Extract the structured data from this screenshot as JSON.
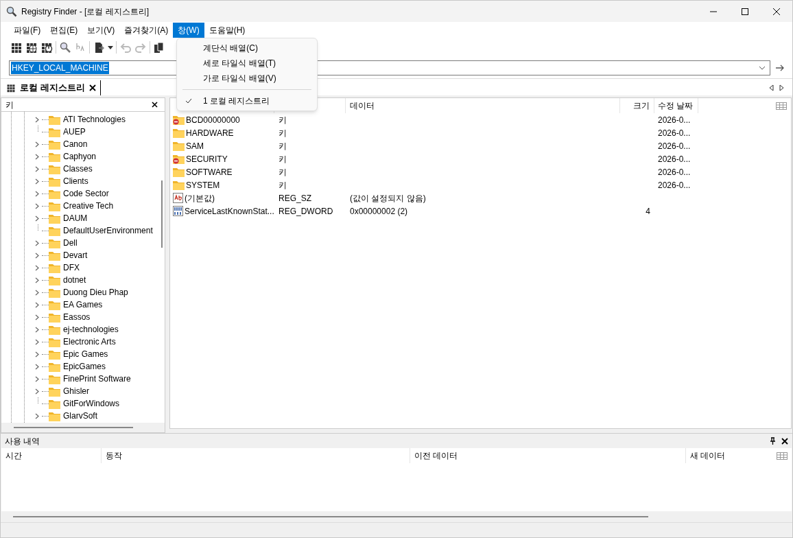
{
  "window": {
    "title": "Registry Finder - [로컬 레지스트리]"
  },
  "menu_bar": [
    {
      "label": "파일(F)",
      "selected": false
    },
    {
      "label": "편집(E)",
      "selected": false
    },
    {
      "label": "보기(V)",
      "selected": false
    },
    {
      "label": "즐겨찾기(A)",
      "selected": false
    },
    {
      "label": "창(W)",
      "selected": true
    },
    {
      "label": "도움말(H)",
      "selected": false
    }
  ],
  "dropdown": {
    "items": [
      {
        "kind": "command",
        "label": "계단식 배열(C)",
        "checked": false
      },
      {
        "kind": "command",
        "label": "세로 타일식 배열(T)",
        "checked": false
      },
      {
        "kind": "command",
        "label": "가로 타일식 배열(V)",
        "checked": false
      },
      {
        "kind": "separator"
      },
      {
        "kind": "command",
        "label": "1 로컬 레지스트리",
        "checked": true
      }
    ]
  },
  "address": {
    "value": "HKEY_LOCAL_MACHINE"
  },
  "tabs": [
    {
      "label": "로컬 레지스트리",
      "selected": true
    }
  ],
  "tree": {
    "header": "키",
    "items": [
      {
        "label": "ATI Technologies",
        "kind": "expandable"
      },
      {
        "label": "AUEP",
        "kind": "leaf"
      },
      {
        "label": "Canon",
        "kind": "expandable"
      },
      {
        "label": "Caphyon",
        "kind": "expandable"
      },
      {
        "label": "Classes",
        "kind": "expandable"
      },
      {
        "label": "Clients",
        "kind": "expandable"
      },
      {
        "label": "Code Sector",
        "kind": "expandable"
      },
      {
        "label": "Creative Tech",
        "kind": "expandable"
      },
      {
        "label": "DAUM",
        "kind": "expandable"
      },
      {
        "label": "DefaultUserEnvironment",
        "kind": "leaf"
      },
      {
        "label": "Dell",
        "kind": "expandable"
      },
      {
        "label": "Devart",
        "kind": "expandable"
      },
      {
        "label": "DFX",
        "kind": "expandable"
      },
      {
        "label": "dotnet",
        "kind": "expandable"
      },
      {
        "label": "Duong Dieu Phap",
        "kind": "expandable"
      },
      {
        "label": "EA Games",
        "kind": "expandable"
      },
      {
        "label": "Eassos",
        "kind": "expandable"
      },
      {
        "label": "ej-technologies",
        "kind": "expandable"
      },
      {
        "label": "Electronic Arts",
        "kind": "expandable"
      },
      {
        "label": "Epic Games",
        "kind": "expandable"
      },
      {
        "label": "EpicGames",
        "kind": "expandable"
      },
      {
        "label": "FinePrint Software",
        "kind": "expandable"
      },
      {
        "label": "Ghisler",
        "kind": "expandable"
      },
      {
        "label": "GitForWindows",
        "kind": "leaf"
      },
      {
        "label": "GlarvSoft",
        "kind": "expandable"
      }
    ]
  },
  "list": {
    "columns": [
      "데이터",
      "크기",
      "수정 날짜"
    ],
    "rows": [
      {
        "kind": "key_denied",
        "name": "BCD00000000",
        "type": "키",
        "date": "2026-0..."
      },
      {
        "kind": "key",
        "name": "HARDWARE",
        "type": "키",
        "date": "2026-0..."
      },
      {
        "kind": "key",
        "name": "SAM",
        "type": "키",
        "date": "2026-0..."
      },
      {
        "kind": "key_denied",
        "name": "SECURITY",
        "type": "키",
        "date": "2026-0..."
      },
      {
        "kind": "key",
        "name": "SOFTWARE",
        "type": "키",
        "date": "2026-0..."
      },
      {
        "kind": "key",
        "name": "SYSTEM",
        "type": "키",
        "date": "2026-0..."
      },
      {
        "kind": "string",
        "name": "(기본값)",
        "type": "REG_SZ",
        "data": "(값이 설정되지 않음)"
      },
      {
        "kind": "dword",
        "name": "ServiceLastKnownStat...",
        "type": "REG_DWORD",
        "data": "0x00000002 (2)",
        "size": "4"
      }
    ]
  },
  "history": {
    "title": "사용 내역",
    "columns": [
      "시간",
      "동작",
      "이전 데이터",
      "새 데이터"
    ]
  }
}
